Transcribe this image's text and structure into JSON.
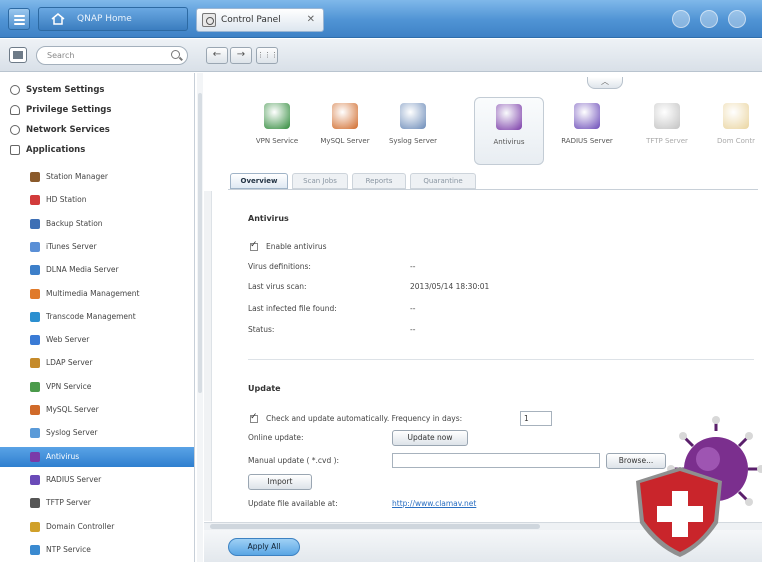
{
  "topbar": {
    "home_label": "QNAP Home",
    "tab_label": "Control Panel",
    "tab_close": "✕"
  },
  "toolbar": {
    "search_placeholder": "Search",
    "back": "←",
    "forward": "→",
    "grid": "⋮⋮⋮"
  },
  "sidebar": {
    "categories": [
      {
        "label": "System Settings",
        "icon": "gear-icon"
      },
      {
        "label": "Privilege Settings",
        "icon": "person-icon"
      },
      {
        "label": "Network Services",
        "icon": "globe-icon"
      },
      {
        "label": "Applications",
        "icon": "apps-icon"
      }
    ],
    "items": [
      {
        "label": "Station Manager",
        "icon": "station-manager-icon",
        "color": "#8a5a2b"
      },
      {
        "label": "HD Station",
        "icon": "hd-station-icon",
        "color": "#d23b3b"
      },
      {
        "label": "Backup Station",
        "icon": "backup-station-icon",
        "color": "#3d6fb5"
      },
      {
        "label": "iTunes Server",
        "icon": "itunes-icon",
        "color": "#5a8fd6"
      },
      {
        "label": "DLNA Media Server",
        "icon": "dlna-icon",
        "color": "#3d7fc9"
      },
      {
        "label": "Multimedia Management",
        "icon": "multimedia-icon",
        "color": "#e07a2a"
      },
      {
        "label": "Transcode Management",
        "icon": "transcode-icon",
        "color": "#2b8fd0"
      },
      {
        "label": "Web Server",
        "icon": "web-server-icon",
        "color": "#3a7bd5"
      },
      {
        "label": "LDAP Server",
        "icon": "ldap-icon",
        "color": "#c58a2a"
      },
      {
        "label": "VPN Service",
        "icon": "vpn-icon",
        "color": "#4a9a4a"
      },
      {
        "label": "MySQL Server",
        "icon": "mysql-icon",
        "color": "#d06a2a"
      },
      {
        "label": "Syslog Server",
        "icon": "syslog-icon",
        "color": "#5a9ad8"
      },
      {
        "label": "Antivirus",
        "icon": "antivirus-icon",
        "color": "#7a3aa8"
      },
      {
        "label": "RADIUS Server",
        "icon": "radius-icon",
        "color": "#6a4ab8"
      },
      {
        "label": "TFTP Server",
        "icon": "tftp-icon",
        "color": "#555555"
      },
      {
        "label": "Domain Controller",
        "icon": "domain-controller-icon",
        "color": "#d0a02a"
      },
      {
        "label": "NTP Service",
        "icon": "ntp-icon",
        "color": "#3a8ad0"
      }
    ],
    "active_index": 12
  },
  "apps": [
    {
      "label": "VPN Service",
      "icon": "vpn-icon",
      "color": "#2f8a3a"
    },
    {
      "label": "MySQL Server",
      "icon": "mysql-icon",
      "color": "#d06a2a"
    },
    {
      "label": "Syslog Server",
      "icon": "syslog-icon",
      "color": "#6a8ab8"
    },
    {
      "label": "Antivirus",
      "icon": "antivirus-icon",
      "color": "#7a3aa8"
    },
    {
      "label": "RADIUS Server",
      "icon": "radius-icon",
      "color": "#6a4ab8"
    },
    {
      "label": "TFTP Server",
      "icon": "tftp-icon",
      "color": "#777777"
    },
    {
      "label": "Dom Contr",
      "icon": "domain-controller-icon",
      "color": "#d0a02a"
    }
  ],
  "tabs": [
    "Overview",
    "Scan Jobs",
    "Reports",
    "Quarantine"
  ],
  "antivirus": {
    "title": "Antivirus",
    "enable_label": "Enable antivirus",
    "rows": [
      {
        "label": "Virus definitions:",
        "value": "--"
      },
      {
        "label": "Last virus scan:",
        "value": "2013/05/14 18:30:01"
      },
      {
        "label": "Last infected file found:",
        "value": "--"
      },
      {
        "label": "Status:",
        "value": "--"
      }
    ]
  },
  "update": {
    "title": "Update",
    "auto_label": "Check and update automatically. Frequency in days:",
    "frequency": "1",
    "online_label": "Online update:",
    "update_now": "Update now",
    "manual_label": "Manual update ( *.cvd ):",
    "browse": "Browse...",
    "import": "Import",
    "available_label": "Update file available at:",
    "available_link": "http://www.clamav.net"
  },
  "footer": {
    "apply_all": "Apply All"
  },
  "colors": {
    "accent": "#3f82c6",
    "active_item": "#2f7fcf",
    "link": "#2a6fc2"
  }
}
